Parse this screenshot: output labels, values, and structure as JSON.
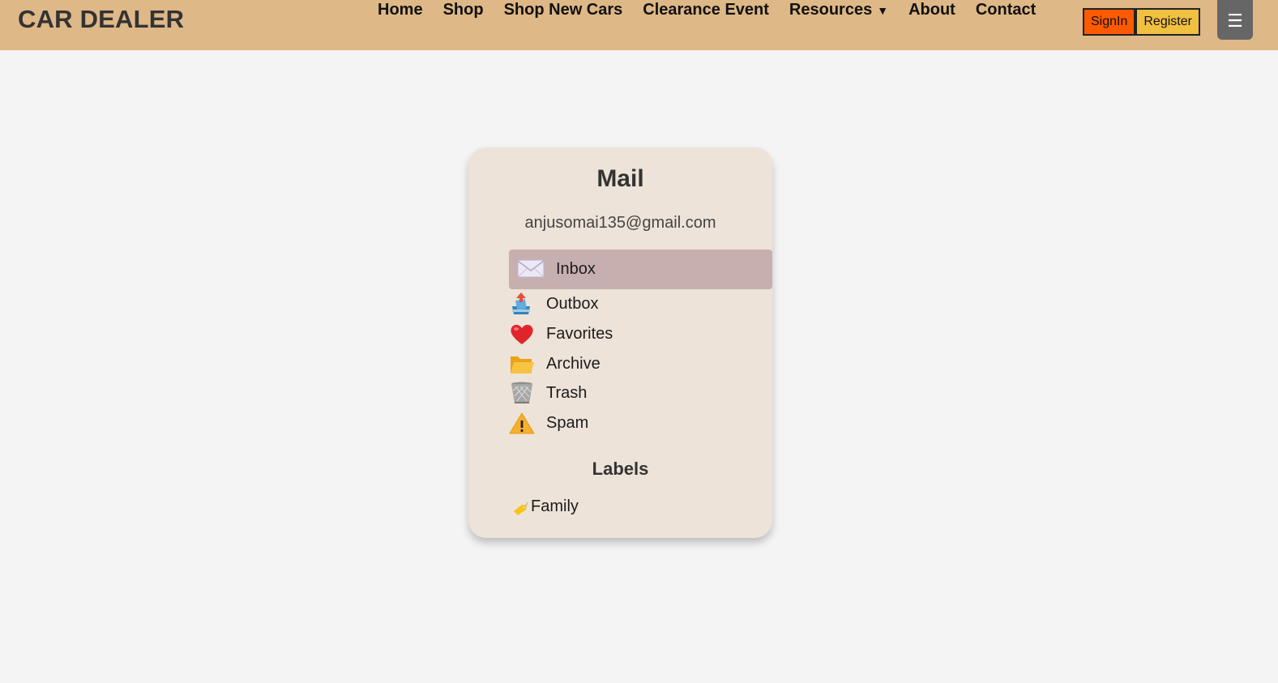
{
  "header": {
    "brand": "CAR DEALER",
    "nav": [
      {
        "label": "Home"
      },
      {
        "label": "Shop"
      },
      {
        "label": "Shop New Cars"
      },
      {
        "label": "Clearance Event"
      },
      {
        "label": "Resources",
        "caret": "▼"
      },
      {
        "label": "About"
      },
      {
        "label": "Contact"
      }
    ],
    "signin_label": "SignIn",
    "register_label": "Register",
    "menu_icon": "☰",
    "colors": {
      "bar": "#deb887",
      "signin": "#ff5a00",
      "register": "#f0c040"
    }
  },
  "mail": {
    "title": "Mail",
    "email": "anjusomai135@gmail.com",
    "folders": [
      {
        "label": "Inbox",
        "icon": "envelope-icon",
        "active": true
      },
      {
        "label": "Outbox",
        "icon": "outbox-tray-icon"
      },
      {
        "label": "Favorites",
        "icon": "heart-icon"
      },
      {
        "label": "Archive",
        "icon": "folder-icon"
      },
      {
        "label": "Trash",
        "icon": "wastebasket-icon"
      },
      {
        "label": "Spam",
        "icon": "warning-icon"
      }
    ],
    "labels_title": "Labels",
    "labels": [
      {
        "label": "Family",
        "icon": "tag-icon"
      }
    ],
    "colors": {
      "card": "#ede3d8",
      "active": "#c8afaf"
    }
  }
}
